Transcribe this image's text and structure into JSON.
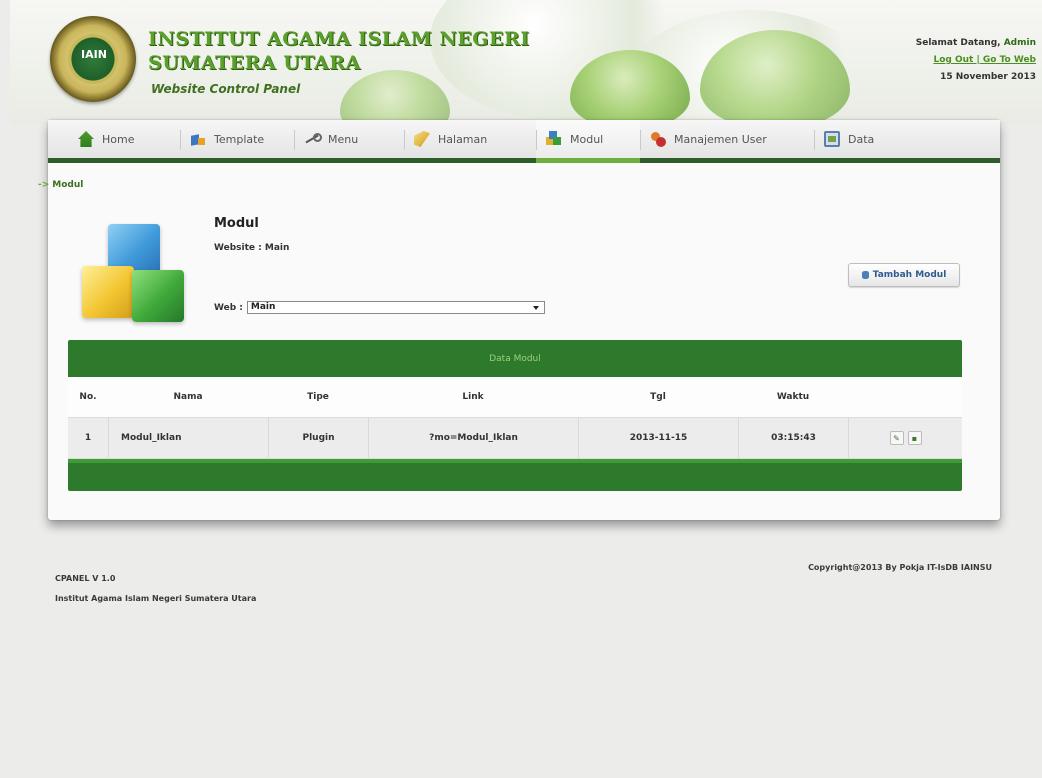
{
  "header": {
    "institution_line1": "INSTITUT AGAMA ISLAM NEGERI",
    "institution_line2": "SUMATERA UTARA",
    "panel_title": "Website Control Panel",
    "logo_text": "IAIN",
    "welcome_prefix": "Selamat Datang,",
    "welcome_user": "Admin",
    "links": "Log Out | Go To Web",
    "date": "15 November 2013"
  },
  "nav": {
    "tabs": [
      {
        "label": "Home",
        "icon": "home-icon"
      },
      {
        "label": "Template",
        "icon": "template-icon"
      },
      {
        "label": "Menu",
        "icon": "menu-icon"
      },
      {
        "label": "Halaman",
        "icon": "halaman-icon"
      },
      {
        "label": "Modul",
        "icon": "modul-icon",
        "active": true
      },
      {
        "label": "Manajemen User",
        "icon": "user-icon"
      },
      {
        "label": "Data",
        "icon": "data-icon"
      }
    ]
  },
  "breadcrumb": "Modul",
  "module": {
    "title": "Modul",
    "website_label": "Website : Main",
    "web_label": "Web :",
    "web_selected": "Main",
    "add_button": "Tambah Modul"
  },
  "table": {
    "caption": "Data Modul",
    "columns": [
      "No.",
      "Nama",
      "Tipe",
      "Link",
      "Tgl",
      "Waktu"
    ],
    "rows": [
      [
        "1",
        "Modul_Iklan",
        "Plugin",
        "?mo=Modul_Iklan",
        "2013-11-15",
        "03:15:43"
      ]
    ]
  },
  "footer": {
    "version": "CPANEL V 1.0",
    "institution": "Institut Agama Islam Negeri Sumatera Utara",
    "copyright": "Copyright@2013 By Pokja IT-IsDB IAINSU"
  },
  "colors": {
    "accent_green": "#2e7a2c",
    "nav_bar": "#2f5d2a",
    "title_green": "#5aa02b"
  }
}
